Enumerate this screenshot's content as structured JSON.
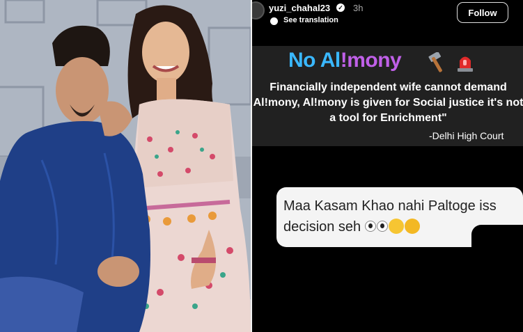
{
  "post": {
    "username": "yuzi_chahal23",
    "time": "3h",
    "translate_label": "See translation",
    "follow_label": "Follow"
  },
  "card": {
    "headline_a": "No Al",
    "headline_b": "!mony",
    "quote": "Financially independent wife cannot demand Al!mony, Al!mony is given for Social justice it's not a tool for Enrichment\"",
    "source": "-Delhi High Court"
  },
  "sticker": {
    "text": "Maa Kasam Khao nahi Paltoge iss decision seh"
  },
  "icons": {
    "verified": "verified-check-icon",
    "translate": "translate-icon",
    "hammer": "hammer-icon",
    "siren": "siren-icon",
    "eyes": "eyes-emoji",
    "rofl": "rofl-emoji",
    "joy": "joy-emoji"
  },
  "colors": {
    "story_bg": "#000000",
    "card_band": "#212121",
    "headline_blue": "#3ab8ff",
    "headline_pink": "#c060e8"
  }
}
